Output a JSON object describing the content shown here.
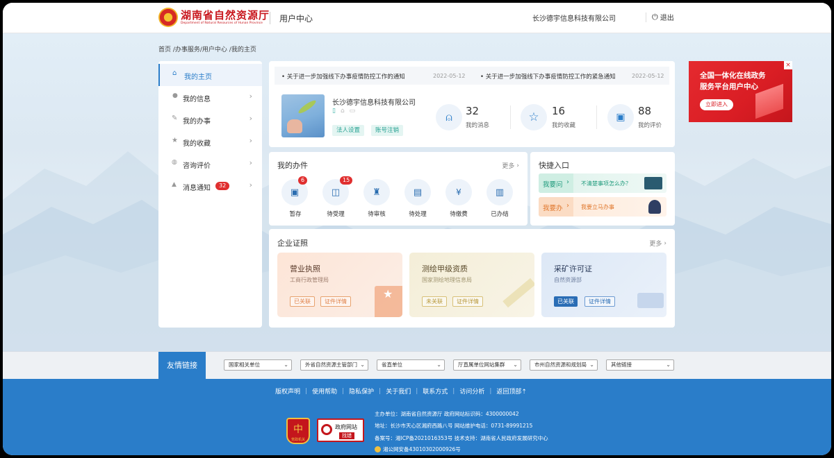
{
  "header": {
    "logo_title": "湖南省自然资源厅",
    "logo_subtitle": "Department of Natural Resources of Hunan Province",
    "section": "用户中心",
    "company": "长沙德宇信息科技有限公司",
    "logout": "退出"
  },
  "breadcrumb": "首页 /办事服务/用户中心 /我的主页",
  "sidebar": {
    "items": [
      {
        "label": "我的主页",
        "icon": "home-icon"
      },
      {
        "label": "我的信息",
        "icon": "user-icon"
      },
      {
        "label": "我的办事",
        "icon": "pencil-icon"
      },
      {
        "label": "我的收藏",
        "icon": "star-icon"
      },
      {
        "label": "咨询评价",
        "icon": "chat-icon"
      },
      {
        "label": "消息通知",
        "icon": "bell-icon",
        "badge": "32"
      }
    ]
  },
  "notices": [
    {
      "text": "• 关于进一步加强线下办事疫情防控工作的通知",
      "date": "2022-05-12"
    },
    {
      "text": "• 关于进一步加强线下办事疫情防控工作的紧急通知",
      "date": "2022-05-12"
    }
  ],
  "profile": {
    "name": "长沙德宇信息科技有限公司",
    "btn_legal": "法人设置",
    "btn_cancel": "账号注销"
  },
  "stats": [
    {
      "value": "32",
      "label": "我的消息"
    },
    {
      "value": "16",
      "label": "我的收藏"
    },
    {
      "value": "88",
      "label": "我的评价"
    }
  ],
  "banner": {
    "line1": "全国一体化在线政务",
    "line2": "服务平台用户中心",
    "button": "立即进入"
  },
  "tasks": {
    "title": "我的办件",
    "more": "更多",
    "items": [
      {
        "label": "暂存",
        "badge": "6"
      },
      {
        "label": "待受理",
        "badge": "15"
      },
      {
        "label": "待审核",
        "badge": ""
      },
      {
        "label": "待处理",
        "badge": ""
      },
      {
        "label": "待缴费",
        "badge": ""
      },
      {
        "label": "已办结",
        "badge": ""
      }
    ]
  },
  "quick": {
    "title": "快捷入口",
    "ask_label": "我要问",
    "ask_text": "不清楚事项怎么办？",
    "do_label": "我要办",
    "do_text": "我要立马办事"
  },
  "licenses": {
    "title": "企业证照",
    "more": "更多",
    "items": [
      {
        "name": "营业执照",
        "org": "工商行政管理局",
        "status": "已关联",
        "detail": "证件详情"
      },
      {
        "name": "测绘甲级资质",
        "org": "国家测绘地理信息局",
        "status": "未关联",
        "detail": "证件详情"
      },
      {
        "name": "采矿许可证",
        "org": "自然资源部",
        "status": "已关联",
        "detail": "证件详情"
      }
    ]
  },
  "friend_links": {
    "title": "友情链接",
    "selects": [
      "国家相关单位",
      "外省自然资源主管部门",
      "省直单位",
      "厅直属单位网站集群",
      "市州自然资源和规划局",
      "其他链接"
    ]
  },
  "footer": {
    "links": [
      "版权声明",
      "使用帮助",
      "隐私保护",
      "关于我们",
      "联系方式",
      "访问分析",
      "返回顶部⇡"
    ],
    "host": "主办单位：湖南省自然资源厅   政府网站标识码：4300000042",
    "address": "地址：长沙市天心区湘府西路八号  网站维护电话：0731-89991215",
    "icp": "备案号：湘ICP备2021016353号   技术支持：湖南省人民政府发展研究中心",
    "police": "湘公网安备43010302000926号",
    "badge_party": "党政机关",
    "badge_gov_line1": "政府网站",
    "badge_gov_line2": "找错"
  },
  "colors": {
    "primary": "#2a7dc9",
    "badge_red": "#e02f2f",
    "banner_red": "#e8262d",
    "footer_blue": "#2a7dc9"
  }
}
